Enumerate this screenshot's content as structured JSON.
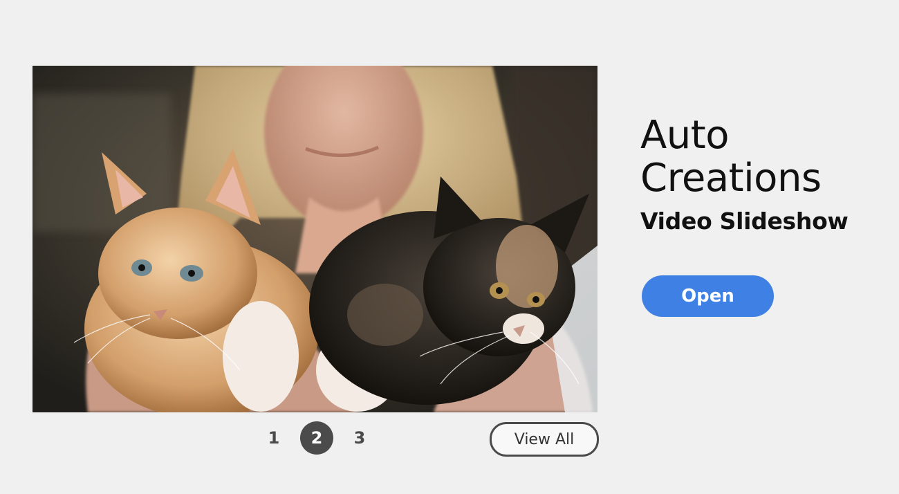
{
  "hero": {
    "image_alt": "Girl holding two kittens, one orange and white, one black and calico"
  },
  "pager": {
    "pages": [
      "1",
      "2",
      "3"
    ],
    "active_index": 1
  },
  "view_all_label": "View All",
  "side": {
    "title": "Auto Creations",
    "subtitle": "Video Slideshow",
    "open_label": "Open"
  },
  "colors": {
    "background": "#f0f0f0",
    "accent": "#3e80e4",
    "active_page": "#4b4b4b"
  }
}
